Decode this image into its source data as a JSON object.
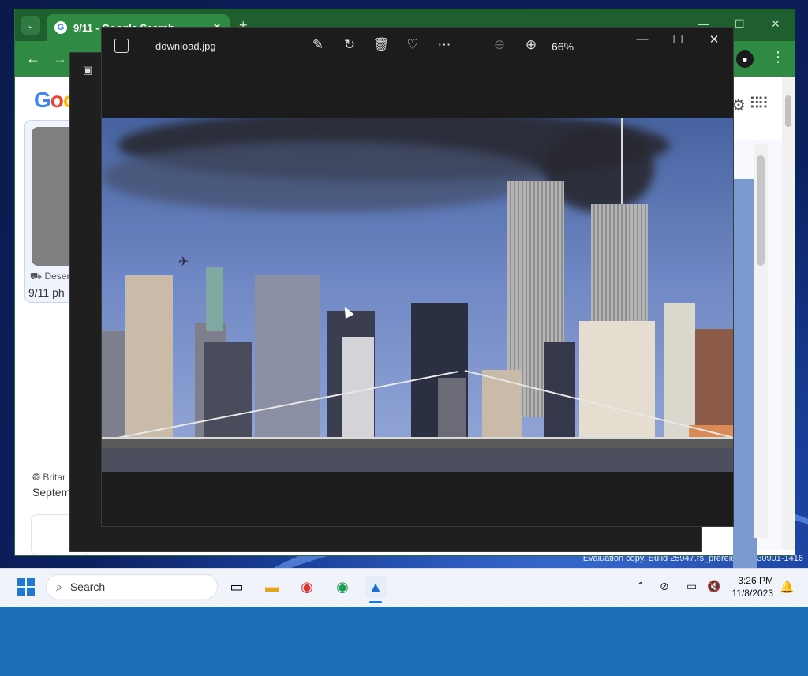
{
  "browser": {
    "tab_title": "9/11 - Google Search",
    "tab_dropdown_icon": "chevron-down-icon",
    "new_tab_icon": "plus-icon",
    "google_logo_text": "Goo",
    "card1": {
      "source": "Deser",
      "title": "9/11 ph"
    },
    "card2": {
      "source": "Britar",
      "title": "Septem"
    }
  },
  "photos_back": {},
  "photos": {
    "file_name": "download.jpg",
    "zoom_level": "66%",
    "toolbar": [
      "edit-image-icon",
      "rotate-icon",
      "delete-icon",
      "favorite-icon",
      "more-icon"
    ],
    "zoom_out_icon": "zoom-out-icon",
    "zoom_in_icon": "zoom-in-icon"
  },
  "watermark": {
    "line1": "Evaluation copy. Build 25947.rs_prerelease.230901-1416"
  },
  "taskbar": {
    "search_placeholder": "Search",
    "time": "3:26 PM",
    "date": "11/8/2023"
  }
}
